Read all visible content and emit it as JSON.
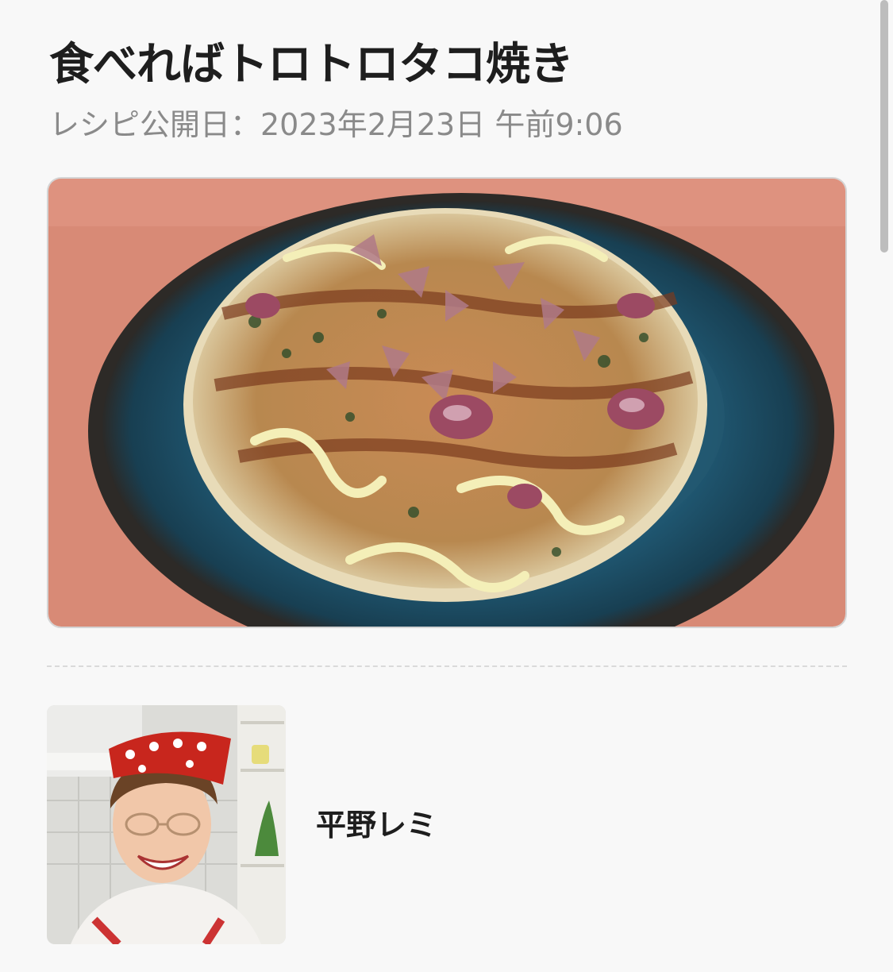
{
  "recipe": {
    "title": "食べればトロトロタコ焼き",
    "published": "レシピ公開日：2023年2月23日 午前9:06"
  },
  "hero_image": {
    "subject": "octopus-okonomiyaki-on-blue-plate"
  },
  "author": {
    "name": "平野レミ",
    "avatar": "chef-portrait"
  },
  "colors": {
    "background": "#f8f8f8",
    "title": "#1e1e1e",
    "subtext": "#8a8a8a",
    "divider": "#dadada"
  }
}
